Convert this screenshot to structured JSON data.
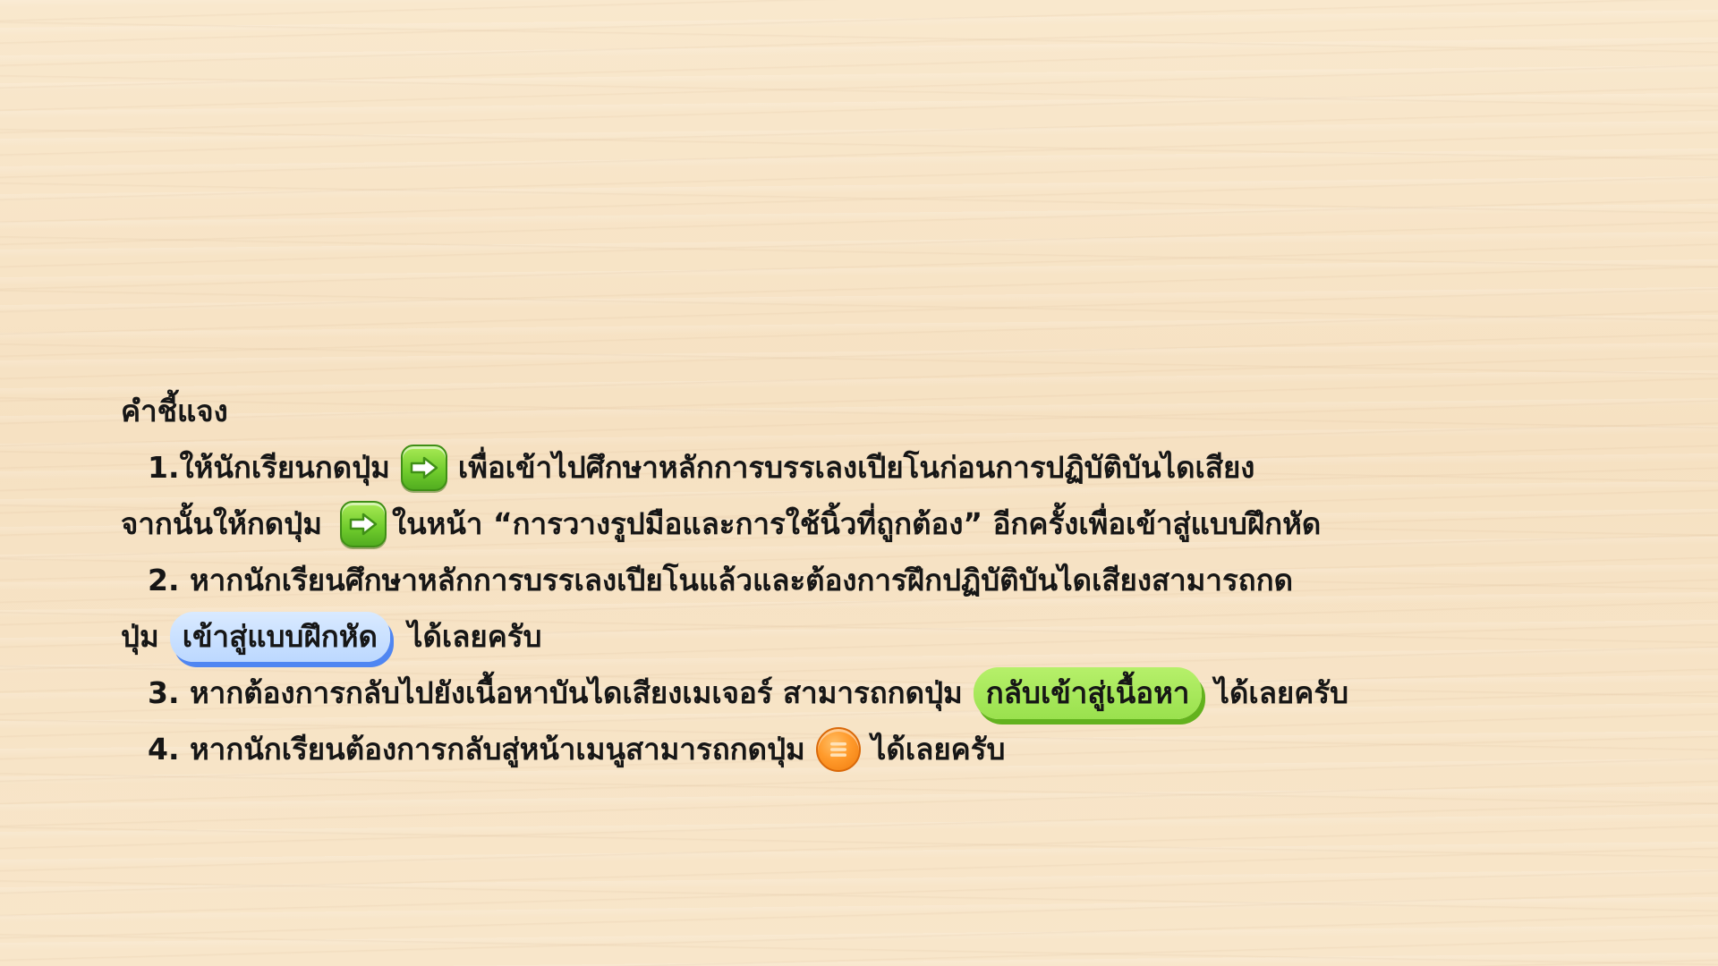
{
  "heading": "คำชี้แจง",
  "item1": {
    "prefix": "1.ให้นักเรียนกดปุ่ม",
    "after_first_button": "เพื่อเข้าไปศึกษาหลักการบรรเลงเปียโนก่อนการปฏิบัติบันไดเสียง",
    "line2_prefix": "จากนั้นให้กดปุ่ม",
    "line2_after_button": "ในหน้า “การวางรูปมือและการใช้นิ้วที่ถูกต้อง” อีกครั้งเพื่อเข้าสู่แบบฝึกหัด",
    "next_icon": "arrow-right-icon"
  },
  "item2": {
    "text": "2. หากนักเรียนศึกษาหลักการบรรเลงเปียโนแล้วและต้องการฝึกปฏิบัติบันไดเสียงสามารถกด",
    "line2_prefix": "ปุ่ม",
    "button_label": "เข้าสู่แบบฝึกหัด",
    "suffix": "ได้เลยครับ"
  },
  "item3": {
    "text": "3. หากต้องการกลับไปยังเนื้อหาบันไดเสียงเมเจอร์ สามารถกดปุ่ม",
    "button_label": "กลับเข้าสู่เนื้อหา",
    "suffix": "ได้เลยครับ"
  },
  "item4": {
    "text": "4. หากนักเรียนต้องการกลับสู่หน้าเมนูสามารถกดปุ่ม",
    "suffix": "ได้เลยครับ",
    "menu_icon": "menu-icon"
  },
  "colors": {
    "green_button": "#7ed23a",
    "blue_button": "#c6ddff",
    "orange_button": "#ff9a2b",
    "background": "#f8e5c8"
  }
}
